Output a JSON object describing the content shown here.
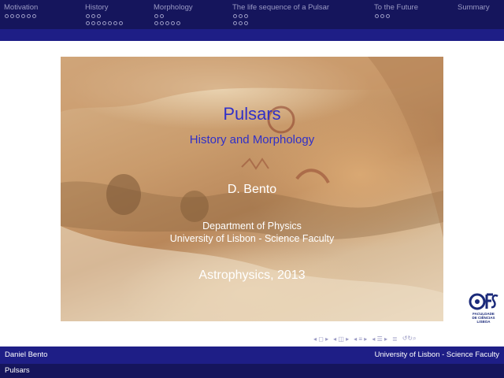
{
  "header": {
    "sections": [
      {
        "label": "Motivation",
        "dot_rows": [
          6
        ]
      },
      {
        "label": "History",
        "dot_rows": [
          3,
          7
        ]
      },
      {
        "label": "Morphology",
        "dot_rows": [
          2,
          5
        ]
      },
      {
        "label": "The life sequence of a Pulsar",
        "dot_rows": [
          3,
          3
        ]
      },
      {
        "label": "To the Future",
        "dot_rows": [
          3
        ]
      },
      {
        "label": "Summary",
        "dot_rows": []
      }
    ]
  },
  "slide": {
    "title": "Pulsars",
    "subtitle": "History and Morphology",
    "author": "D. Bento",
    "institute_line1": "Department of Physics",
    "institute_line2": "University of Lisbon - Science Faculty",
    "date": "Astrophysics, 2013"
  },
  "logo": {
    "text_line1": "FACULDADE",
    "text_line2": "DE CIÊNCIAS",
    "text_line3": "LISBOA"
  },
  "footer": {
    "author": "Daniel Bento",
    "institute": "University of Lisbon - Science Faculty",
    "short_title": "Pulsars"
  },
  "colors": {
    "header_bg": "#15155c",
    "band_bg": "#1e1e86",
    "title_color": "#3030c8",
    "nav_text": "#9a9ac4"
  }
}
